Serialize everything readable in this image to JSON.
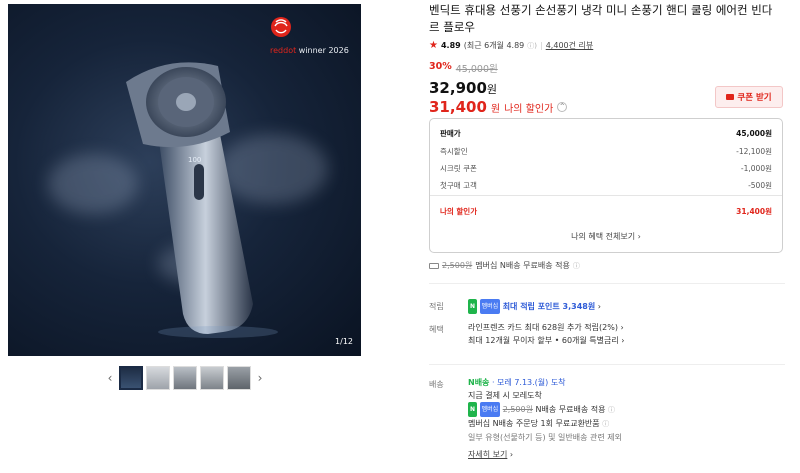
{
  "gallery": {
    "award_text_red": "reddot",
    "award_text": " winner 2026",
    "counter": "1/12",
    "thumb_count": 5,
    "active_thumb": 0
  },
  "product": {
    "title": "벤딕트 휴대용 선풍기 손선풍기 냉각 미니 손풍기 핸디 쿨링 에어컨 빈다르 플로우",
    "rating": "4.89",
    "rating_recent": "(최근 6개월 4.89",
    "review_count": "4,400건 리뷰",
    "discount_pct": "30%",
    "original_price": "45,000원",
    "price": "32,900",
    "price_unit": "원",
    "my_price": "31,400",
    "my_price_unit": "원",
    "my_price_label": "나의 할인가",
    "coupon_button": "쿠폰 받기"
  },
  "breakdown": {
    "rows": [
      {
        "label": "판매가",
        "value": "45,000원"
      },
      {
        "label": "즉시할인",
        "value": "-12,100원"
      },
      {
        "label": "시크릿 쿠폰",
        "value": "-1,000원"
      },
      {
        "label": "첫구매 고객",
        "value": "-500원"
      }
    ],
    "total_label": "나의 할인가",
    "total_value": "31,400원",
    "view_all": "나의 혜택 전체보기"
  },
  "shipping_note": {
    "strike": "2,500원",
    "text": "멤버십 N배송 무료배송 적용"
  },
  "points": {
    "label": "적립",
    "badge": "N",
    "badge2": "멤버십",
    "text": "최대 적립 포인트 3,348원"
  },
  "benefits": {
    "label": "혜택",
    "line1": "라인프렌즈 카드 최대 628원 추가 적립(2%)",
    "line2": "최대 12개월 무이자 할부 • 60개월 특별금리"
  },
  "delivery": {
    "label": "배송",
    "badge": "N배송",
    "arrival": "· 모레 7.13.(월) 도착",
    "line2": "지금 결제 시 모레도착",
    "line3_strike": "2,500원",
    "line3": "N배송 무료배송 적용",
    "line4": "멤버십 N배송 주문당 1회 무료교환반품",
    "line5": "일부 유형(선물하기 등) 및 일반배송 관련 제외",
    "details": "자세히 보기"
  },
  "colors": {
    "accent": "#e0251b",
    "npay_green": "#1fb44b"
  }
}
